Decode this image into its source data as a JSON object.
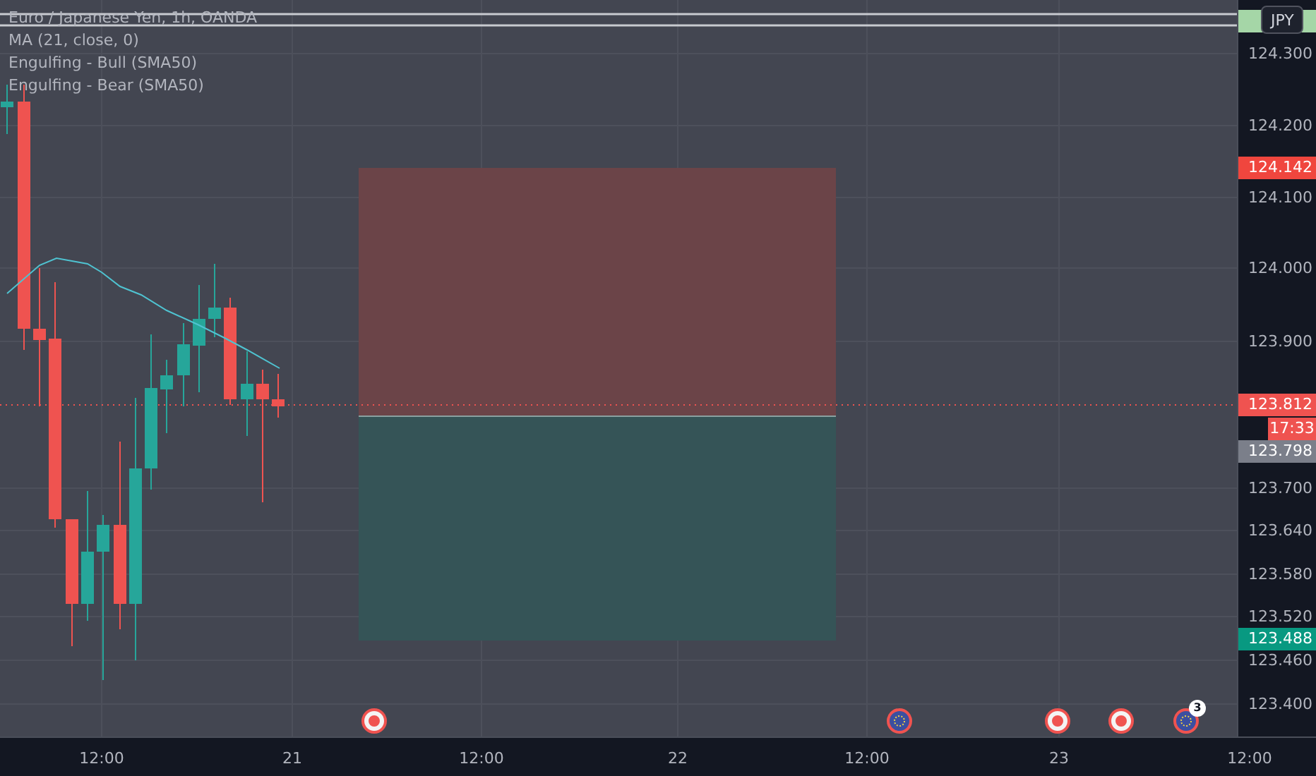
{
  "legend": {
    "title": "Euro / Japanese Yen, 1h, OANDA",
    "indicators": [
      "MA (21, close, 0)",
      "Engulfing - Bull (SMA50)",
      "Engulfing - Bear (SMA50)"
    ]
  },
  "currency_button": "JPY",
  "price_scale": {
    "ticks": [
      "124.300",
      "124.200",
      "124.100",
      "124.000",
      "123.900",
      "123.700",
      "123.640",
      "123.580",
      "123.520",
      "123.460",
      "123.400"
    ],
    "markers": [
      {
        "label": "124.142",
        "color": "#f0463e"
      },
      {
        "label": "123.812",
        "color": "#ef5350"
      },
      {
        "label": "17:33",
        "color": "#ef5350"
      },
      {
        "label": "123.798",
        "color": "#7b7f8a"
      },
      {
        "label": "123.488",
        "color": "#089981"
      }
    ]
  },
  "time_scale": {
    "ticks": [
      "12:00",
      "21",
      "12:00",
      "22",
      "12:00",
      "23",
      "12:00"
    ]
  },
  "events": [
    {
      "kind": "dot"
    },
    {
      "kind": "flag"
    },
    {
      "kind": "dot"
    },
    {
      "kind": "dot"
    },
    {
      "kind": "flag",
      "count": "3"
    }
  ]
}
